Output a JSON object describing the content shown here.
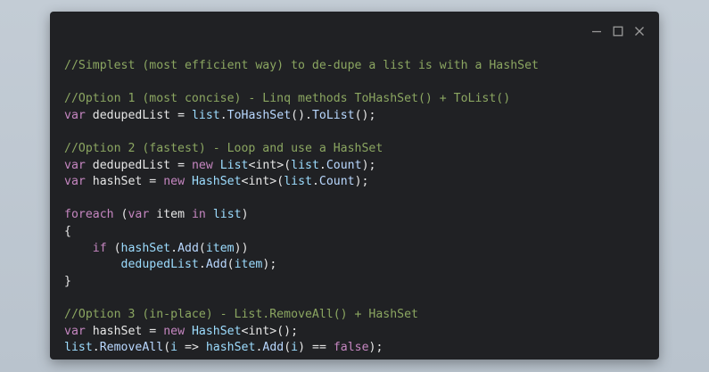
{
  "window": {
    "controls": {
      "minimize_icon": "minimize-icon",
      "maximize_icon": "maximize-icon",
      "close_icon": "close-icon"
    }
  },
  "colors": {
    "background": "#bfc8d1",
    "window": "#202124",
    "comment": "#8ba661",
    "keyword": "#c586c0",
    "identifier": "#9cdcfe",
    "text": "#e6e6e6"
  },
  "code_lines": [
    [
      {
        "t": "comment",
        "v": "//Simplest (most efficient way) to de-dupe a list is with a HashSet"
      }
    ],
    [],
    [
      {
        "t": "comment",
        "v": "//Option 1 (most concise) - Linq methods ToHashSet() + ToList()"
      }
    ],
    [
      {
        "t": "keyword",
        "v": "var"
      },
      {
        "t": "punct",
        "v": " "
      },
      {
        "t": "var",
        "v": "dedupedList"
      },
      {
        "t": "punct",
        "v": " = "
      },
      {
        "t": "ident",
        "v": "list"
      },
      {
        "t": "punct",
        "v": "."
      },
      {
        "t": "method",
        "v": "ToHashSet"
      },
      {
        "t": "punct",
        "v": "()."
      },
      {
        "t": "method",
        "v": "ToList"
      },
      {
        "t": "punct",
        "v": "();"
      }
    ],
    [],
    [
      {
        "t": "comment",
        "v": "//Option 2 (fastest) - Loop and use a HashSet"
      }
    ],
    [
      {
        "t": "keyword",
        "v": "var"
      },
      {
        "t": "punct",
        "v": " "
      },
      {
        "t": "var",
        "v": "dedupedList"
      },
      {
        "t": "punct",
        "v": " = "
      },
      {
        "t": "keyword",
        "v": "new"
      },
      {
        "t": "punct",
        "v": " "
      },
      {
        "t": "type",
        "v": "List"
      },
      {
        "t": "punct",
        "v": "<int>("
      },
      {
        "t": "ident",
        "v": "list"
      },
      {
        "t": "punct",
        "v": "."
      },
      {
        "t": "method",
        "v": "Count"
      },
      {
        "t": "punct",
        "v": ");"
      }
    ],
    [
      {
        "t": "keyword",
        "v": "var"
      },
      {
        "t": "punct",
        "v": " "
      },
      {
        "t": "var",
        "v": "hashSet"
      },
      {
        "t": "punct",
        "v": " = "
      },
      {
        "t": "keyword",
        "v": "new"
      },
      {
        "t": "punct",
        "v": " "
      },
      {
        "t": "type",
        "v": "HashSet"
      },
      {
        "t": "punct",
        "v": "<int>("
      },
      {
        "t": "ident",
        "v": "list"
      },
      {
        "t": "punct",
        "v": "."
      },
      {
        "t": "method",
        "v": "Count"
      },
      {
        "t": "punct",
        "v": ");"
      }
    ],
    [],
    [
      {
        "t": "keyword",
        "v": "foreach"
      },
      {
        "t": "punct",
        "v": " ("
      },
      {
        "t": "keyword",
        "v": "var"
      },
      {
        "t": "punct",
        "v": " "
      },
      {
        "t": "var",
        "v": "item"
      },
      {
        "t": "punct",
        "v": " "
      },
      {
        "t": "keyword",
        "v": "in"
      },
      {
        "t": "punct",
        "v": " "
      },
      {
        "t": "ident",
        "v": "list"
      },
      {
        "t": "punct",
        "v": ")"
      }
    ],
    [
      {
        "t": "punct",
        "v": "{"
      }
    ],
    [
      {
        "t": "punct",
        "v": "    "
      },
      {
        "t": "keyword",
        "v": "if"
      },
      {
        "t": "punct",
        "v": " ("
      },
      {
        "t": "ident",
        "v": "hashSet"
      },
      {
        "t": "punct",
        "v": "."
      },
      {
        "t": "method",
        "v": "Add"
      },
      {
        "t": "punct",
        "v": "("
      },
      {
        "t": "ident",
        "v": "item"
      },
      {
        "t": "punct",
        "v": "))"
      }
    ],
    [
      {
        "t": "punct",
        "v": "        "
      },
      {
        "t": "ident",
        "v": "dedupedList"
      },
      {
        "t": "punct",
        "v": "."
      },
      {
        "t": "method",
        "v": "Add"
      },
      {
        "t": "punct",
        "v": "("
      },
      {
        "t": "ident",
        "v": "item"
      },
      {
        "t": "punct",
        "v": ");"
      }
    ],
    [
      {
        "t": "punct",
        "v": "}"
      }
    ],
    [],
    [
      {
        "t": "comment",
        "v": "//Option 3 (in-place) - List.RemoveAll() + HashSet"
      }
    ],
    [
      {
        "t": "keyword",
        "v": "var"
      },
      {
        "t": "punct",
        "v": " "
      },
      {
        "t": "var",
        "v": "hashSet"
      },
      {
        "t": "punct",
        "v": " = "
      },
      {
        "t": "keyword",
        "v": "new"
      },
      {
        "t": "punct",
        "v": " "
      },
      {
        "t": "type",
        "v": "HashSet"
      },
      {
        "t": "punct",
        "v": "<int>();"
      }
    ],
    [
      {
        "t": "ident",
        "v": "list"
      },
      {
        "t": "punct",
        "v": "."
      },
      {
        "t": "method",
        "v": "RemoveAll"
      },
      {
        "t": "punct",
        "v": "("
      },
      {
        "t": "ident",
        "v": "i"
      },
      {
        "t": "punct",
        "v": " => "
      },
      {
        "t": "ident",
        "v": "hashSet"
      },
      {
        "t": "punct",
        "v": "."
      },
      {
        "t": "method",
        "v": "Add"
      },
      {
        "t": "punct",
        "v": "("
      },
      {
        "t": "ident",
        "v": "i"
      },
      {
        "t": "punct",
        "v": ") == "
      },
      {
        "t": "literal",
        "v": "false"
      },
      {
        "t": "punct",
        "v": ");"
      }
    ]
  ]
}
